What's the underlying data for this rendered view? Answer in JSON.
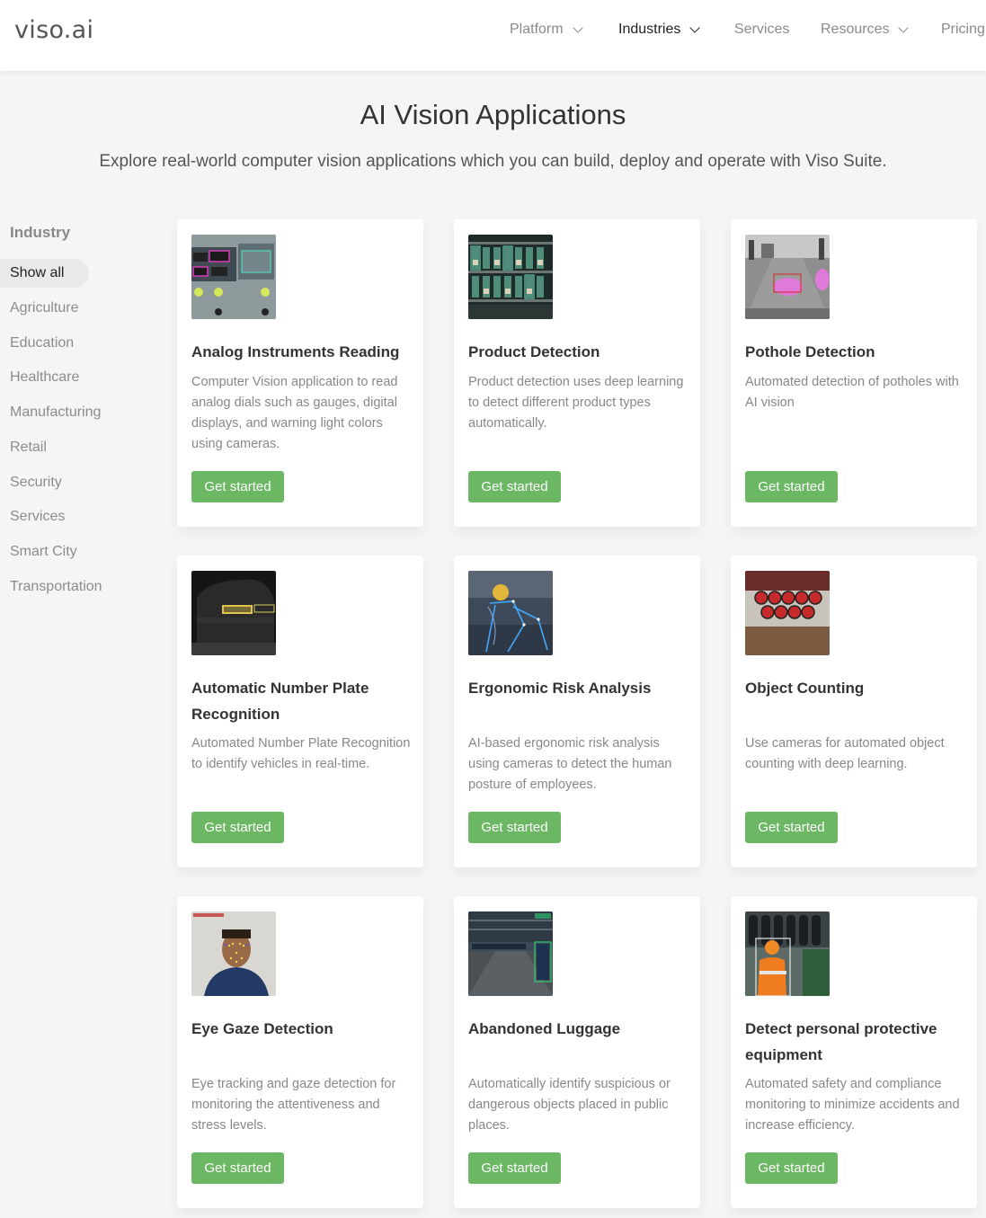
{
  "header": {
    "logo": "viso.ai",
    "nav": [
      {
        "label": "Platform"
      },
      {
        "label": "Industries"
      },
      {
        "label": "Services"
      },
      {
        "label": "Resources"
      },
      {
        "label": "Pricing"
      }
    ]
  },
  "hero": {
    "title": "AI Vision Applications",
    "subtitle": "Explore real-world computer vision applications which you can build, deploy and operate with Viso Suite."
  },
  "sidebar": {
    "heading": "Industry",
    "items": [
      {
        "label": "Show all"
      },
      {
        "label": "Agriculture"
      },
      {
        "label": "Education"
      },
      {
        "label": "Healthcare"
      },
      {
        "label": "Manufacturing"
      },
      {
        "label": "Retail"
      },
      {
        "label": "Security"
      },
      {
        "label": "Services"
      },
      {
        "label": "Smart City"
      },
      {
        "label": "Transportation"
      }
    ]
  },
  "cards": [
    {
      "title": "Analog Instruments Reading",
      "description": "Computer Vision application to read analog dials such as gauges, digital displays, and warning light colors using cameras.",
      "button": "Get started"
    },
    {
      "title": "Product Detection",
      "description": "Product detection uses deep learning to detect different product types automatically.",
      "button": "Get started"
    },
    {
      "title": "Pothole Detection",
      "description": "Automated detection of potholes with AI vision",
      "button": "Get started"
    },
    {
      "title": "Automatic Number Plate Recognition",
      "description": "Automated Number Plate Recognition to identify vehicles in real-time.",
      "button": "Get started"
    },
    {
      "title": "Ergonomic Risk Analysis",
      "description": "AI-based ergonomic risk analysis using cameras to detect the human posture of employees.",
      "button": "Get started"
    },
    {
      "title": "Object Counting",
      "description": "Use cameras for automated object counting with deep learning.",
      "button": "Get started"
    },
    {
      "title": "Eye Gaze Detection",
      "description": "Eye tracking and gaze detection for monitoring the attentiveness and stress levels.",
      "button": "Get started"
    },
    {
      "title": "Abandoned Luggage",
      "description": "Automatically identify suspicious or dangerous objects placed in public places.",
      "button": "Get started"
    },
    {
      "title": "Detect personal protective equipment",
      "description": "Automated safety and compliance monitoring to minimize accidents and increase efficiency.",
      "button": "Get started"
    }
  ],
  "colors": {
    "accent": "#6cb764",
    "background": "#f5f5f5"
  }
}
